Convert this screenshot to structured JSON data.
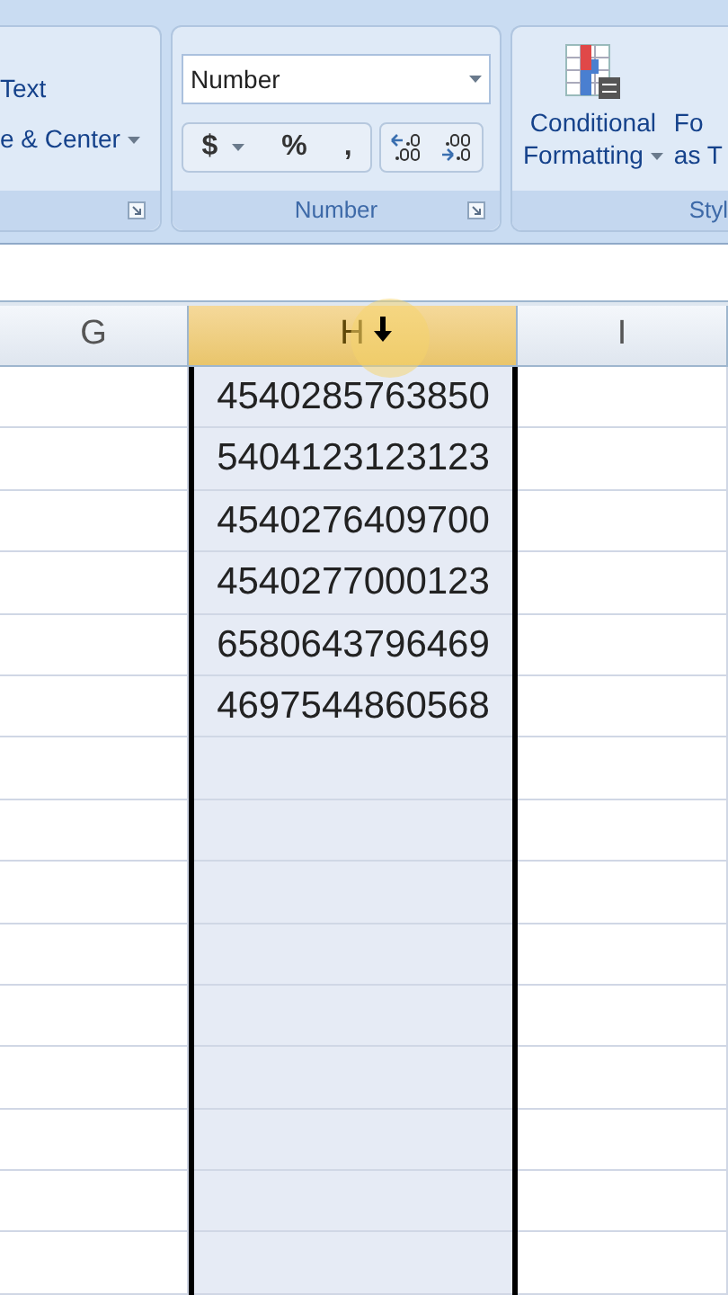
{
  "ribbon": {
    "alignment_group": {
      "wrap_text": "Text",
      "merge_center": "e & Center"
    },
    "number_group": {
      "format_dropdown": "Number",
      "buttons": [
        {
          "kind": "dropdown",
          "label": "$"
        },
        {
          "kind": "plain",
          "label": "%"
        },
        {
          "kind": "plain",
          "label": ","
        }
      ],
      "label": "Number"
    },
    "styles_group": {
      "conditional_formatting": [
        "Conditional",
        "Formatting"
      ],
      "format_as_table": [
        "Fo",
        "as T"
      ],
      "label": "Styl"
    }
  },
  "sheet": {
    "columns": [
      {
        "label": "G",
        "selected": false
      },
      {
        "label": "H",
        "selected": true
      },
      {
        "label": "I",
        "selected": false
      }
    ],
    "column_h_values": [
      "4540285763850",
      "5404123123123",
      "4540276409700",
      "4540277000123",
      "6580643796469",
      "4697544860568"
    ]
  }
}
